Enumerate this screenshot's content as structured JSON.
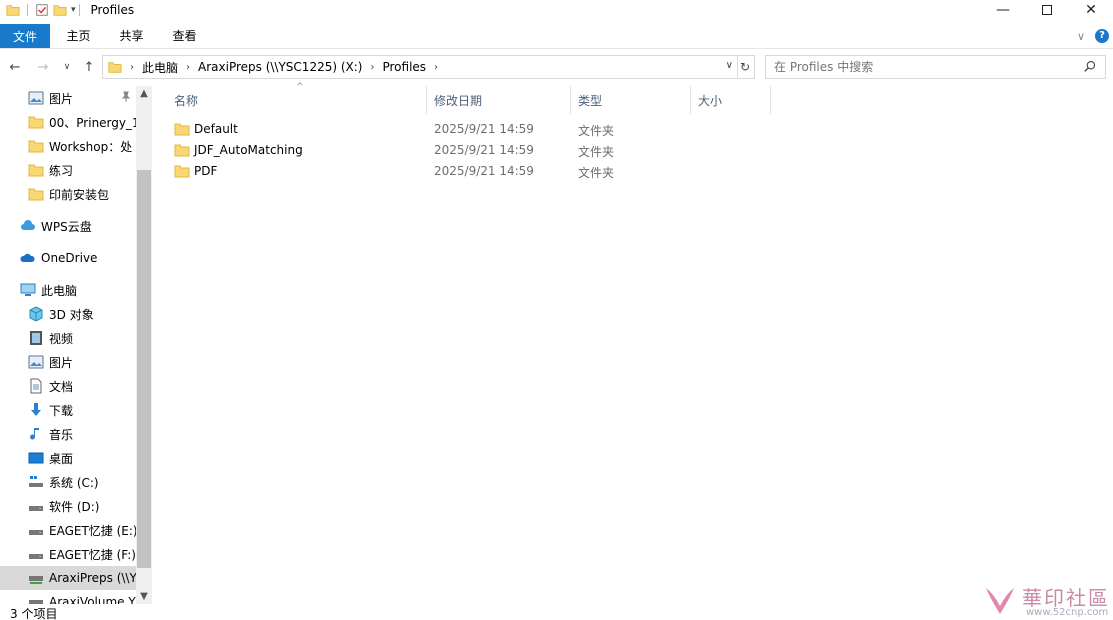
{
  "window": {
    "title": "Profiles"
  },
  "ribbon": {
    "tabs": [
      "文件",
      "主页",
      "共享",
      "查看"
    ]
  },
  "address": {
    "crumbs": [
      "此电脑",
      "AraxiPreps (\\\\YSC1225) (X:)",
      "Profiles"
    ]
  },
  "search": {
    "placeholder": "在 Profiles 中搜索"
  },
  "nav": {
    "quick_access": [
      "图片",
      "00、Prinergy_1",
      "Workshop：处",
      "练习",
      "印前安装包"
    ],
    "wps": "WPS云盘",
    "onedrive": "OneDrive",
    "this_pc": "此电脑",
    "pc_items": [
      "3D 对象",
      "视频",
      "图片",
      "文档",
      "下载",
      "音乐",
      "桌面",
      "系统 (C:)",
      "软件 (D:)",
      "EAGET忆捷 (E:)",
      "EAGET忆捷 (F:)",
      "AraxiPreps (\\\\Y",
      "AraxiVolume Y"
    ]
  },
  "columns": [
    "名称",
    "修改日期",
    "类型",
    "大小"
  ],
  "files": [
    {
      "name": "Default",
      "date": "2025/9/21 14:59",
      "type": "文件夹"
    },
    {
      "name": "JDF_AutoMatching",
      "date": "2025/9/21 14:59",
      "type": "文件夹"
    },
    {
      "name": "PDF",
      "date": "2025/9/21 14:59",
      "type": "文件夹"
    }
  ],
  "status": {
    "count": "3 个项目"
  },
  "watermark": {
    "text": "華印社區",
    "url": "www.52cnp.com"
  },
  "colors": {
    "accent": "#1979ca",
    "folder": "#f8d775",
    "folder_dark": "#e2b740",
    "selection": "#d9d9d9"
  }
}
